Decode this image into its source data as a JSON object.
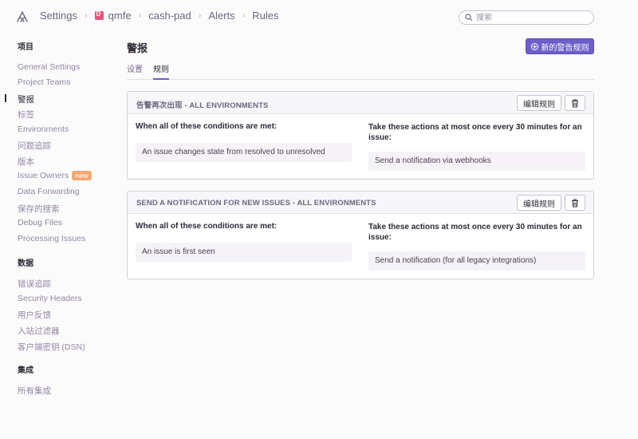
{
  "breadcrumb": {
    "items": [
      "Settings",
      "qmfe",
      "cash-pad",
      "Alerts",
      "Rules"
    ]
  },
  "search": {
    "placeholder": "搜索"
  },
  "sidebar": {
    "section_project": "项目",
    "project_items": [
      "General Settings",
      "Project Teams",
      "警报",
      "标签",
      "Environments",
      "问题追踪",
      "版本",
      "Issue Owners",
      "Data Forwarding",
      "保存的搜索",
      "Debug Files",
      "Processing Issues"
    ],
    "new_badge": "new",
    "section_data": "数据",
    "data_items": [
      "错误追踪",
      "Security Headers",
      "用户反馈",
      "入站过滤器",
      "客户端密钥 (DSN)"
    ],
    "section_integrations": "集成",
    "integration_items": [
      "所有集成"
    ]
  },
  "main": {
    "title": "警报",
    "new_rule_button": "新的警告规则",
    "tabs": [
      "设置",
      "规则"
    ]
  },
  "rules": [
    {
      "title": "告警再次出现 - ALL ENVIRONMENTS",
      "edit_label": "编辑规则",
      "conditions_label": "When  all  of these conditions are met:",
      "condition": "An issue changes state from resolved to unresolved",
      "actions_label": "Take these actions at most  once every 30 minutes  for an issue:",
      "action": "Send a notification via webhooks"
    },
    {
      "title": "SEND A NOTIFICATION FOR NEW ISSUES - ALL ENVIRONMENTS",
      "edit_label": "编辑规则",
      "conditions_label": "When  all  of these conditions are met:",
      "condition": "An issue is first seen",
      "actions_label": "Take these actions at most  once every 30 minutes  for an issue:",
      "action": "Send a notification (for all legacy integrations)"
    }
  ],
  "colors": {
    "accent": "#6c5fc7",
    "new_badge": "#f9a66d",
    "project_badge": "#e1567c"
  },
  "icons": {
    "logo": "sentry-logo-icon",
    "search": "search-icon",
    "delete": "trash-icon",
    "add": "plus-circle-icon"
  }
}
